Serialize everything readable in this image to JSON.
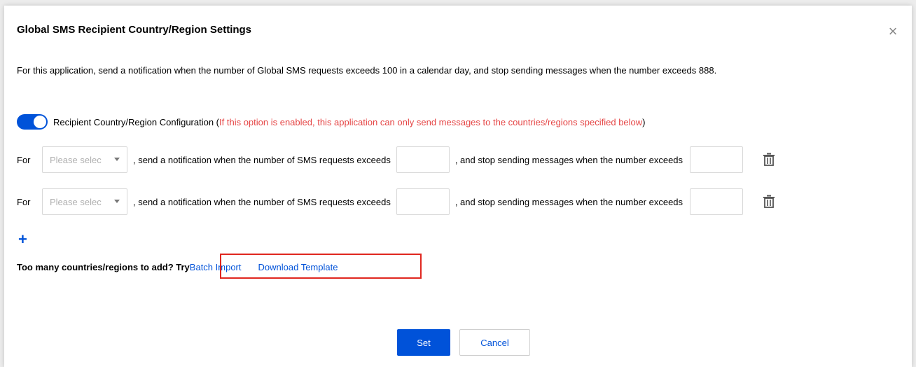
{
  "dialog": {
    "title": "Global SMS Recipient Country/Region Settings",
    "close_symbol": "×",
    "description": "For this application, send a notification when the number of Global SMS requests exceeds 100 in a calendar day, and stop sending messages when the number exceeds 888."
  },
  "toggle": {
    "enabled": true,
    "label": "Recipient Country/Region Configuration (",
    "warning": "If this option is enabled, this application can only send messages to the countries/regions specified below",
    "close_paren": ")"
  },
  "rules": [
    {
      "for_label": "For",
      "select_placeholder": "Please selec",
      "notify_text": ", send a notification when the number of SMS requests exceeds",
      "notify_value": "",
      "stop_text": ", and stop sending messages when the number exceeds",
      "stop_value": ""
    },
    {
      "for_label": "For",
      "select_placeholder": "Please selec",
      "notify_text": ", send a notification when the number of SMS requests exceeds",
      "notify_value": "",
      "stop_text": ", and stop sending messages when the number exceeds",
      "stop_value": ""
    }
  ],
  "add_symbol": "+",
  "import": {
    "prompt": "Too many countries/regions to add? Try",
    "batch_import": "Batch Import",
    "download_template": "Download Template"
  },
  "footer": {
    "set_label": "Set",
    "cancel_label": "Cancel"
  },
  "colors": {
    "accent": "#0052d9",
    "warning": "#e54545",
    "highlight": "#e0271f"
  },
  "icons": {
    "close": "close-icon",
    "delete": "trash-icon",
    "dropdown": "chevron-down-icon",
    "add": "plus-icon"
  }
}
